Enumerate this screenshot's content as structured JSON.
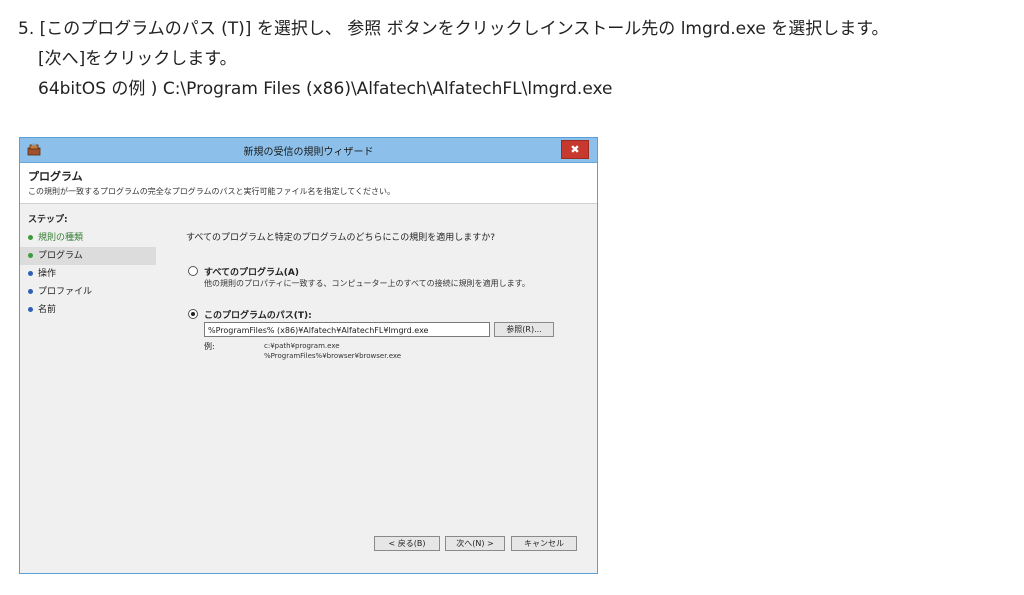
{
  "instructions": {
    "line1": "5. [このプログラムのパス (T)] を選択し、 参照 ボタンをクリックしインストール先の lmgrd.exe を選択します。",
    "line2": "[次へ]をクリックします。",
    "line3": "64bitOS の例 ) C:\\Program Files (x86)\\Alfatech\\AlfatechFL\\lmgrd.exe"
  },
  "dialog": {
    "title": "新規の受信の規則ウィザード",
    "close_glyph": "✖",
    "header_title": "プログラム",
    "header_desc": "この規則が一致するプログラムの完全なプログラムのパスと実行可能ファイル名を指定してください。",
    "steps_heading": "ステップ:",
    "steps": [
      "規則の種類",
      "プログラム",
      "操作",
      "プロファイル",
      "名前"
    ],
    "question": "すべてのプログラムと特定のプログラムのどちらにこの規則を適用しますか?",
    "option_all_label": "すべてのプログラム(A)",
    "option_all_desc": "他の規則のプロパティに一致する、コンピューター上のすべての接続に規則を適用します。",
    "option_path_label": "このプログラムのパス(T):",
    "path_value": "%ProgramFiles% (x86)¥Alfatech¥AlfatechFL¥lmgrd.exe",
    "browse_label": "参照(R)...",
    "example_label": "例:",
    "example_lines": [
      "c:¥path¥program.exe",
      "%ProgramFiles%¥browser¥browser.exe"
    ],
    "back_label": "< 戻る(B)",
    "next_label": "次へ(N) >",
    "cancel_label": "キャンセル"
  },
  "colors": {
    "titlebar": "#8cc0ea",
    "close_button": "#c7392e",
    "step_done": "#3c9b3c",
    "step_todo": "#2f5fb5"
  },
  "icons": [
    "wizard-app-icon",
    "close-icon",
    "radio-icon"
  ]
}
